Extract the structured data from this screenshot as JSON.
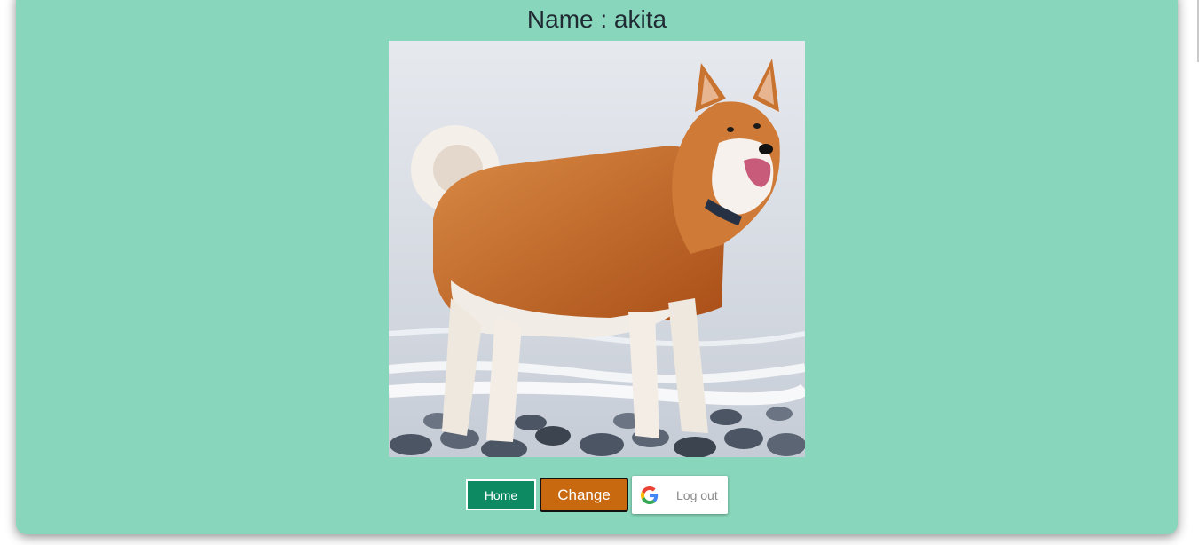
{
  "header": {
    "title": "Name : akita"
  },
  "image": {
    "alt": "akita",
    "icon": "dog-photo"
  },
  "actions": {
    "home_label": "Home",
    "change_label": "Change",
    "logout_label": "Log out",
    "logout_icon": "google-g-icon"
  },
  "colors": {
    "card_background": "#88d6bb",
    "home_button": "#0e8a62",
    "change_button": "#c8680f",
    "logout_button": "#ffffff"
  }
}
